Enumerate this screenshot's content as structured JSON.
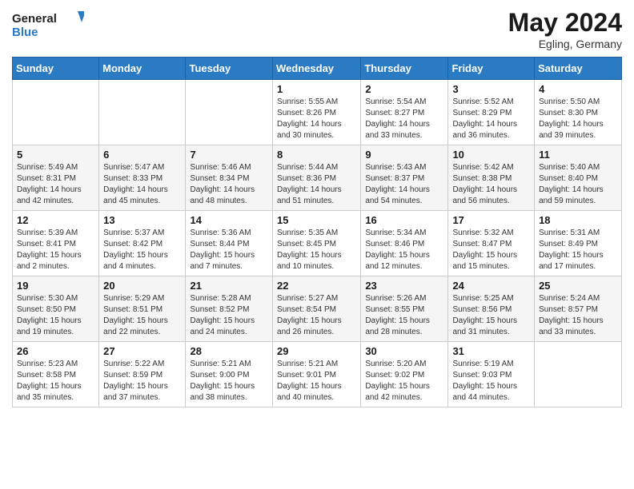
{
  "header": {
    "logo_line1": "General",
    "logo_line2": "Blue",
    "title": "May 2024",
    "location": "Egling, Germany"
  },
  "days_of_week": [
    "Sunday",
    "Monday",
    "Tuesday",
    "Wednesday",
    "Thursday",
    "Friday",
    "Saturday"
  ],
  "weeks": [
    [
      {
        "day": "",
        "info": ""
      },
      {
        "day": "",
        "info": ""
      },
      {
        "day": "",
        "info": ""
      },
      {
        "day": "1",
        "info": "Sunrise: 5:55 AM\nSunset: 8:26 PM\nDaylight: 14 hours and 30 minutes."
      },
      {
        "day": "2",
        "info": "Sunrise: 5:54 AM\nSunset: 8:27 PM\nDaylight: 14 hours and 33 minutes."
      },
      {
        "day": "3",
        "info": "Sunrise: 5:52 AM\nSunset: 8:29 PM\nDaylight: 14 hours and 36 minutes."
      },
      {
        "day": "4",
        "info": "Sunrise: 5:50 AM\nSunset: 8:30 PM\nDaylight: 14 hours and 39 minutes."
      }
    ],
    [
      {
        "day": "5",
        "info": "Sunrise: 5:49 AM\nSunset: 8:31 PM\nDaylight: 14 hours and 42 minutes."
      },
      {
        "day": "6",
        "info": "Sunrise: 5:47 AM\nSunset: 8:33 PM\nDaylight: 14 hours and 45 minutes."
      },
      {
        "day": "7",
        "info": "Sunrise: 5:46 AM\nSunset: 8:34 PM\nDaylight: 14 hours and 48 minutes."
      },
      {
        "day": "8",
        "info": "Sunrise: 5:44 AM\nSunset: 8:36 PM\nDaylight: 14 hours and 51 minutes."
      },
      {
        "day": "9",
        "info": "Sunrise: 5:43 AM\nSunset: 8:37 PM\nDaylight: 14 hours and 54 minutes."
      },
      {
        "day": "10",
        "info": "Sunrise: 5:42 AM\nSunset: 8:38 PM\nDaylight: 14 hours and 56 minutes."
      },
      {
        "day": "11",
        "info": "Sunrise: 5:40 AM\nSunset: 8:40 PM\nDaylight: 14 hours and 59 minutes."
      }
    ],
    [
      {
        "day": "12",
        "info": "Sunrise: 5:39 AM\nSunset: 8:41 PM\nDaylight: 15 hours and 2 minutes."
      },
      {
        "day": "13",
        "info": "Sunrise: 5:37 AM\nSunset: 8:42 PM\nDaylight: 15 hours and 4 minutes."
      },
      {
        "day": "14",
        "info": "Sunrise: 5:36 AM\nSunset: 8:44 PM\nDaylight: 15 hours and 7 minutes."
      },
      {
        "day": "15",
        "info": "Sunrise: 5:35 AM\nSunset: 8:45 PM\nDaylight: 15 hours and 10 minutes."
      },
      {
        "day": "16",
        "info": "Sunrise: 5:34 AM\nSunset: 8:46 PM\nDaylight: 15 hours and 12 minutes."
      },
      {
        "day": "17",
        "info": "Sunrise: 5:32 AM\nSunset: 8:47 PM\nDaylight: 15 hours and 15 minutes."
      },
      {
        "day": "18",
        "info": "Sunrise: 5:31 AM\nSunset: 8:49 PM\nDaylight: 15 hours and 17 minutes."
      }
    ],
    [
      {
        "day": "19",
        "info": "Sunrise: 5:30 AM\nSunset: 8:50 PM\nDaylight: 15 hours and 19 minutes."
      },
      {
        "day": "20",
        "info": "Sunrise: 5:29 AM\nSunset: 8:51 PM\nDaylight: 15 hours and 22 minutes."
      },
      {
        "day": "21",
        "info": "Sunrise: 5:28 AM\nSunset: 8:52 PM\nDaylight: 15 hours and 24 minutes."
      },
      {
        "day": "22",
        "info": "Sunrise: 5:27 AM\nSunset: 8:54 PM\nDaylight: 15 hours and 26 minutes."
      },
      {
        "day": "23",
        "info": "Sunrise: 5:26 AM\nSunset: 8:55 PM\nDaylight: 15 hours and 28 minutes."
      },
      {
        "day": "24",
        "info": "Sunrise: 5:25 AM\nSunset: 8:56 PM\nDaylight: 15 hours and 31 minutes."
      },
      {
        "day": "25",
        "info": "Sunrise: 5:24 AM\nSunset: 8:57 PM\nDaylight: 15 hours and 33 minutes."
      }
    ],
    [
      {
        "day": "26",
        "info": "Sunrise: 5:23 AM\nSunset: 8:58 PM\nDaylight: 15 hours and 35 minutes."
      },
      {
        "day": "27",
        "info": "Sunrise: 5:22 AM\nSunset: 8:59 PM\nDaylight: 15 hours and 37 minutes."
      },
      {
        "day": "28",
        "info": "Sunrise: 5:21 AM\nSunset: 9:00 PM\nDaylight: 15 hours and 38 minutes."
      },
      {
        "day": "29",
        "info": "Sunrise: 5:21 AM\nSunset: 9:01 PM\nDaylight: 15 hours and 40 minutes."
      },
      {
        "day": "30",
        "info": "Sunrise: 5:20 AM\nSunset: 9:02 PM\nDaylight: 15 hours and 42 minutes."
      },
      {
        "day": "31",
        "info": "Sunrise: 5:19 AM\nSunset: 9:03 PM\nDaylight: 15 hours and 44 minutes."
      },
      {
        "day": "",
        "info": ""
      }
    ]
  ]
}
